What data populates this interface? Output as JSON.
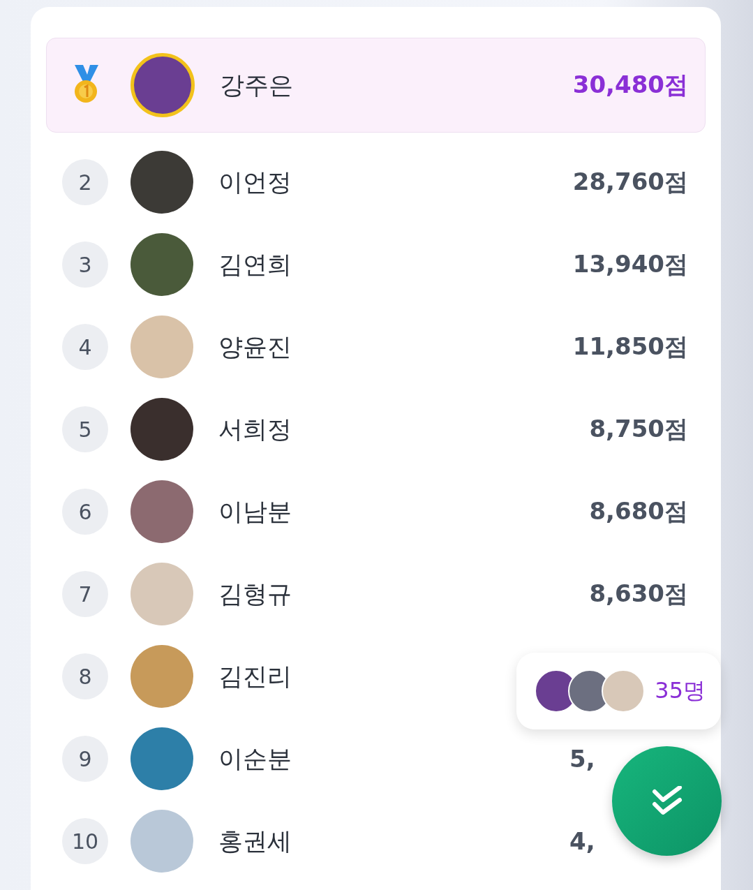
{
  "leaderboard": [
    {
      "kind": "medal",
      "name": "강주은",
      "score": "30,480점",
      "selected": true
    },
    {
      "kind": "number",
      "rank": "2",
      "name": "이언정",
      "score": "28,760점",
      "selected": false
    },
    {
      "kind": "number",
      "rank": "3",
      "name": "김연희",
      "score": "13,940점",
      "selected": false
    },
    {
      "kind": "number",
      "rank": "4",
      "name": "양윤진",
      "score": "11,850점",
      "selected": false
    },
    {
      "kind": "number",
      "rank": "5",
      "name": "서희정",
      "score": "8,750점",
      "selected": false
    },
    {
      "kind": "number",
      "rank": "6",
      "name": "이남분",
      "score": "8,680점",
      "selected": false
    },
    {
      "kind": "number",
      "rank": "7",
      "name": "김형규",
      "score": "8,630점",
      "selected": false
    },
    {
      "kind": "number",
      "rank": "8",
      "name": "김진리",
      "selected": false
    },
    {
      "kind": "number",
      "rank": "9",
      "name": "이순분",
      "score": "5,",
      "covered": true,
      "selected": false
    },
    {
      "kind": "number",
      "rank": "10",
      "name": "홍권세",
      "score": "4,",
      "covered": true,
      "selected": false
    }
  ],
  "participants": {
    "count": "35명"
  }
}
